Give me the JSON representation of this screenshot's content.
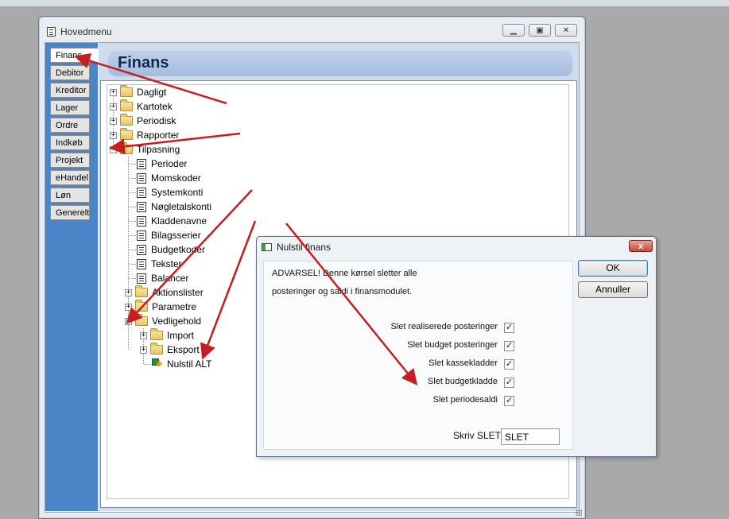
{
  "window": {
    "title": "Hovedmenu"
  },
  "tabs": [
    "Finans",
    "Debitor",
    "Kreditor",
    "Lager",
    "Ordre",
    "Indkøb",
    "Projekt",
    "eHandel",
    "Løn",
    "Generelt"
  ],
  "content": {
    "header": "Finans"
  },
  "tree": {
    "top": [
      "Dagligt",
      "Kartotek",
      "Periodisk",
      "Rapporter"
    ],
    "tilpasning": "Tilpasning",
    "tilpasning_children": [
      "Perioder",
      "Momskoder",
      "Systemkonti",
      "Nøgletalskonti",
      "Kladdenavne",
      "Bilagsserier",
      "Budgetkoder",
      "Tekster",
      "Balancer"
    ],
    "after": [
      "Aktionslister",
      "Parametre"
    ],
    "vedligehold": "Vedligehold",
    "vedligehold_children": [
      "Import",
      "Eksport"
    ],
    "nulstil": "Nulstil ALT"
  },
  "dialog": {
    "title": "Nulstil finans",
    "close": "x",
    "warning_line1": "ADVARSEL! Denne kørsel sletter alle",
    "warning_line2": "posteringer og saldi i finansmodulet.",
    "options": [
      {
        "label": "Slet realiserede posteringer",
        "checked": true
      },
      {
        "label": "Slet budget posteringer",
        "checked": true
      },
      {
        "label": "Slet kassekladder",
        "checked": true
      },
      {
        "label": "Slet budgetkladde",
        "checked": true
      },
      {
        "label": "Slet periodesaldi",
        "checked": true
      }
    ],
    "check_glyph": "✓",
    "input_label": "Skriv SLET",
    "input_value": "SLET",
    "ok": "OK",
    "cancel": "Annuller"
  },
  "colors": {
    "tab_strip": "#4a85c8",
    "annotation_arrow": "#c41e1e"
  }
}
